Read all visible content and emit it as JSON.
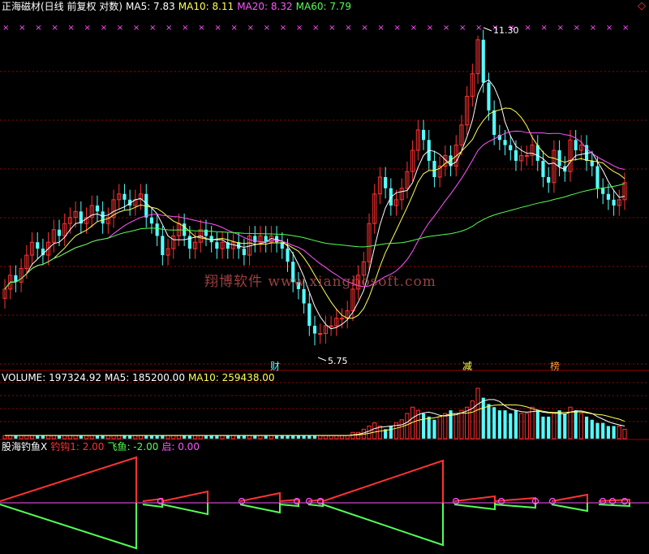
{
  "header": {
    "title": "正海磁材(日线 前复权 对数)",
    "ma5": "MA5: 7.83",
    "ma10": "MA10: 8.11",
    "ma20": "MA20: 8.32",
    "ma60": "MA60: 7.79",
    "corner_icon": "diamond-icon"
  },
  "volume_header": {
    "label": "VOLUME: 197324.92",
    "ma5": "MA5: 185200.00",
    "ma10": "MA10: 259438.00"
  },
  "indicator_header": {
    "name": "股海钓鱼X",
    "gou": "钓钩1: 2.00",
    "fei": "飞鱼: -2.00",
    "qi": "启: 0.00"
  },
  "annotations": {
    "high": "11.30",
    "low": "5.75",
    "event_cai": "财",
    "event_jian": "减",
    "event_bang": "榜"
  },
  "watermark": "翔博软件 www.xiangbosoft.com",
  "colors": {
    "background": "#000000",
    "up": "#ff3232",
    "down": "#54ffff",
    "ma5": "#ffffff",
    "ma10": "#ffff54",
    "ma20": "#ff54ff",
    "ma60": "#54ff54",
    "grid": "#a00000",
    "marker": "#ff54ff"
  },
  "chart_data": {
    "type": "candlestick",
    "closes": [
      6.5,
      6.7,
      6.6,
      6.8,
      7.0,
      7.2,
      7.1,
      7.0,
      7.2,
      7.4,
      7.3,
      7.5,
      7.6,
      7.7,
      7.5,
      7.6,
      7.8,
      7.7,
      7.5,
      7.6,
      7.9,
      8.0,
      7.9,
      7.8,
      7.9,
      8.0,
      7.6,
      7.5,
      7.3,
      7.0,
      7.1,
      7.3,
      7.5,
      7.3,
      7.1,
      7.2,
      7.4,
      7.3,
      7.2,
      7.1,
      7.2,
      7.1,
      7.2,
      7.1,
      7.0,
      7.3,
      7.2,
      7.3,
      7.2,
      7.3,
      7.2,
      7.1,
      6.9,
      6.6,
      6.5,
      6.3,
      6.0,
      5.9,
      5.9,
      6.0,
      6.0,
      6.1,
      6.1,
      6.2,
      6.5,
      6.7,
      6.9,
      7.5,
      8.0,
      8.3,
      8.1,
      7.8,
      7.9,
      8.1,
      8.4,
      8.8,
      9.2,
      9.0,
      8.6,
      8.3,
      8.5,
      8.7,
      8.5,
      8.9,
      9.3,
      9.9,
      10.4,
      11.2,
      10.2,
      9.6,
      9.1,
      9.0,
      8.9,
      8.8,
      8.6,
      8.7,
      8.7,
      8.9,
      8.6,
      8.3,
      8.2,
      8.8,
      8.5,
      8.4,
      9.0,
      8.8,
      8.9,
      8.6,
      8.5,
      8.1,
      8.0,
      7.9,
      7.8,
      7.9,
      8.2
    ],
    "price_range": [
      5.6,
      11.5
    ],
    "high_point": 11.3,
    "low_point": 5.75,
    "volume": [
      1,
      1,
      1,
      1,
      1,
      1,
      1,
      1,
      1,
      1,
      1,
      1,
      1,
      1,
      1,
      1,
      1,
      1,
      1,
      1,
      1,
      1,
      1,
      1,
      1,
      1,
      1,
      1,
      1,
      1,
      1,
      1,
      1,
      1,
      1,
      1,
      1,
      1,
      1,
      1,
      1,
      1,
      1,
      1,
      1,
      1,
      1,
      1,
      1,
      1,
      1,
      1,
      1,
      1,
      1,
      1,
      1,
      1,
      1,
      1,
      1,
      1,
      1,
      1,
      2,
      2,
      3,
      4,
      5,
      4,
      3,
      4,
      5,
      6,
      8,
      10,
      9,
      8,
      7,
      6,
      7,
      8,
      9,
      8,
      9,
      10,
      12,
      16,
      13,
      11,
      10,
      9,
      9,
      8,
      9,
      8,
      8,
      10,
      9,
      7,
      7,
      8,
      9,
      8,
      10,
      9,
      8,
      7,
      6,
      5,
      5,
      4,
      4,
      4,
      3
    ],
    "indicator": {
      "series": [
        {
          "name": "钓钩1",
          "value": 2.0
        },
        {
          "name": "飞鱼",
          "value": -2.0
        },
        {
          "name": "启",
          "value": 0.0
        }
      ]
    }
  }
}
